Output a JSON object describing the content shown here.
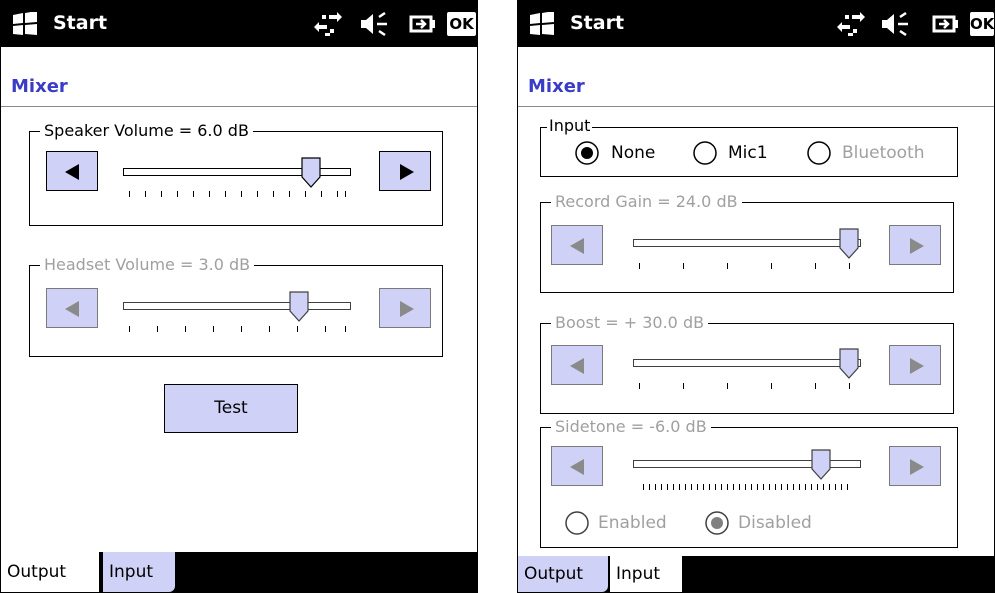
{
  "left": {
    "titlebar": {
      "start_label": "Start",
      "ok_label": "OK"
    },
    "app_title": "Mixer",
    "speaker_group": {
      "label": "Speaker Volume =  6.0 dB",
      "level": 0.85
    },
    "headset_group": {
      "label": "Headset Volume =  3.0 dB",
      "level": 0.8
    },
    "test_button": "Test",
    "tabs": [
      {
        "label": "Output"
      },
      {
        "label": "Input"
      }
    ]
  },
  "right": {
    "titlebar": {
      "start_label": "Start",
      "ok_label": "OK"
    },
    "app_title": "Mixer",
    "input_group": {
      "label": "Input",
      "options": [
        {
          "label": "None",
          "selected": true
        },
        {
          "label": "Mic1",
          "selected": false
        },
        {
          "label": "Bluetooth",
          "selected": false,
          "disabled": true
        }
      ]
    },
    "record_gain_group": {
      "label": "Record Gain =  24.0 dB",
      "level": 1.0
    },
    "boost_group": {
      "label": "Boost = + 30.0 dB",
      "level": 1.0
    },
    "sidetone_group": {
      "label": "Sidetone =  -6.0 dB",
      "level": 0.8,
      "options": [
        {
          "label": "Enabled",
          "selected": false
        },
        {
          "label": "Disabled",
          "selected": true
        }
      ]
    },
    "tabs": [
      {
        "label": "Output"
      },
      {
        "label": "Input"
      }
    ]
  },
  "colors": {
    "accent_title": "#3a3cc8",
    "button_fill": "#cfd1f6",
    "disabled_text": "#a0a0a0"
  },
  "icons": [
    "windows-logo-icon",
    "connectivity-icon",
    "speaker-muted-icon",
    "battery-power-icon"
  ]
}
